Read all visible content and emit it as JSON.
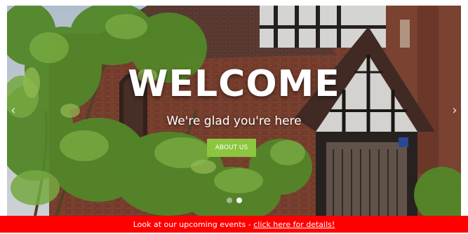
{
  "hero": {
    "title": "WELCOME",
    "subtitle": "We're glad you're here",
    "button_label": "ABOUT US",
    "button_color": "#8cc63f",
    "arrow_left": "‹",
    "arrow_right": "›",
    "slides": 2,
    "active_slide": 2
  },
  "banner": {
    "text": "Look at our upcoming events - ",
    "link_text": "click here for details!",
    "background": "#ff0000"
  },
  "icons": [
    "chevron-left-icon",
    "chevron-right-icon"
  ]
}
